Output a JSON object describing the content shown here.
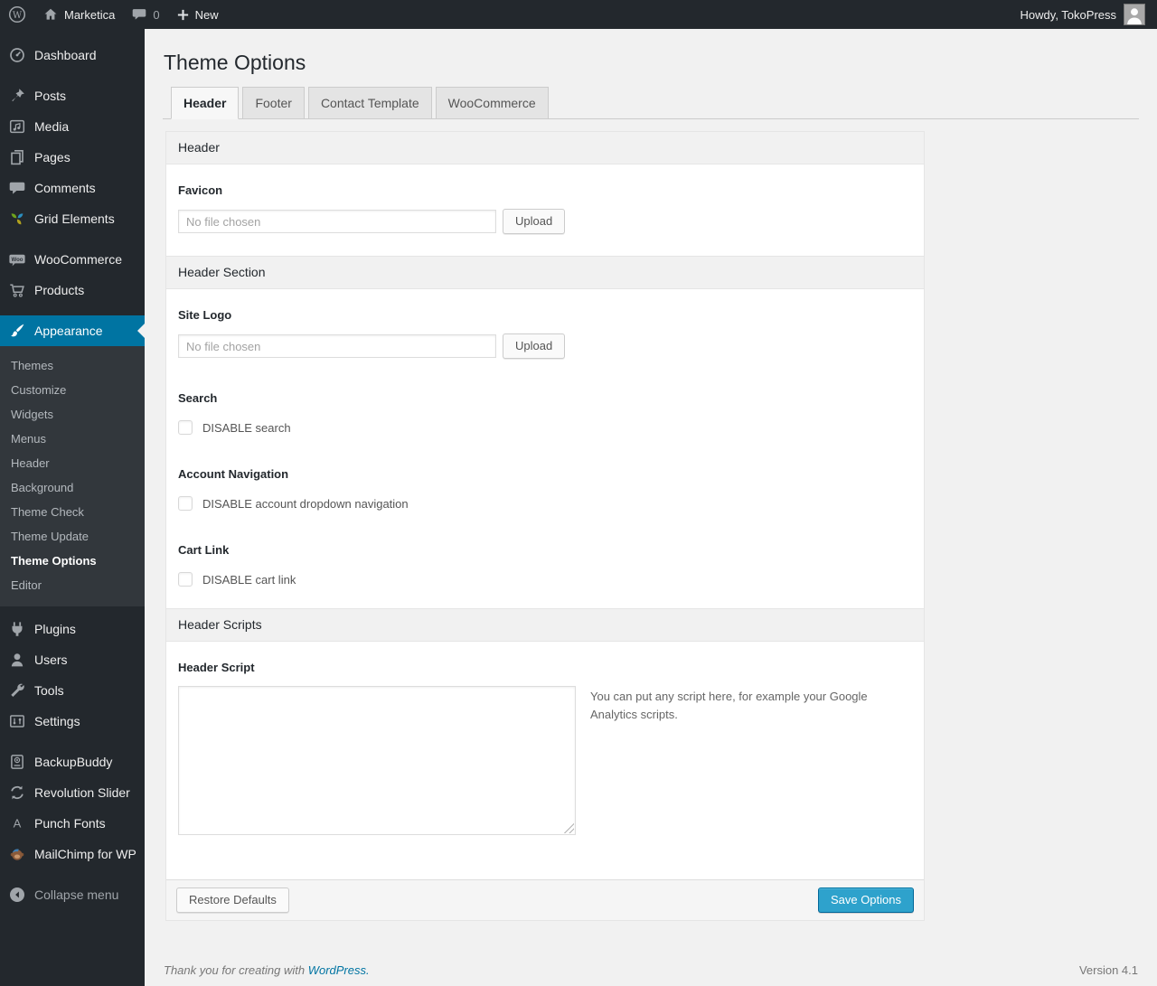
{
  "colors": {
    "admin_bar_bg": "#23282d",
    "submenu_bg": "#32373c",
    "accent_blue": "#0074a2",
    "primary_button": "#2ea2cc",
    "content_bg": "#f1f1f1"
  },
  "admin_bar": {
    "site_name": "Marketica",
    "comment_count": "0",
    "new_label": "New",
    "howdy": "Howdy, TokoPress"
  },
  "sidebar": {
    "dashboard": "Dashboard",
    "posts": "Posts",
    "media": "Media",
    "pages": "Pages",
    "comments": "Comments",
    "grid_elements": "Grid Elements",
    "woocommerce": "WooCommerce",
    "products": "Products",
    "appearance": "Appearance",
    "submenu": [
      "Themes",
      "Customize",
      "Widgets",
      "Menus",
      "Header",
      "Background",
      "Theme Check",
      "Theme Update",
      "Theme Options",
      "Editor"
    ],
    "plugins": "Plugins",
    "users": "Users",
    "tools": "Tools",
    "settings": "Settings",
    "backupbuddy": "BackupBuddy",
    "revolution_slider": "Revolution Slider",
    "punch_fonts": "Punch Fonts",
    "mailchimp": "MailChimp for WP",
    "collapse": "Collapse menu"
  },
  "page": {
    "title": "Theme Options",
    "tabs": [
      "Header",
      "Footer",
      "Contact Template",
      "WooCommerce"
    ]
  },
  "panel": {
    "sections": {
      "header": "Header",
      "header_section": "Header Section",
      "header_scripts": "Header Scripts"
    },
    "favicon": {
      "label": "Favicon",
      "placeholder": "No file chosen",
      "upload": "Upload"
    },
    "site_logo": {
      "label": "Site Logo",
      "placeholder": "No file chosen",
      "upload": "Upload"
    },
    "search": {
      "label": "Search",
      "checkbox_label": "DISABLE search"
    },
    "account_navigation": {
      "label": "Account Navigation",
      "checkbox_label": "DISABLE account dropdown navigation"
    },
    "cart_link": {
      "label": "Cart Link",
      "checkbox_label": "DISABLE cart link"
    },
    "header_script": {
      "label": "Header Script",
      "value": "",
      "help": "You can put any script here, for example your Google Analytics scripts."
    },
    "actions": {
      "restore": "Restore Defaults",
      "save": "Save Options"
    }
  },
  "page_footer": {
    "thanks": "Thank you for creating with",
    "wordpress": "WordPress.",
    "version": "Version 4.1"
  }
}
